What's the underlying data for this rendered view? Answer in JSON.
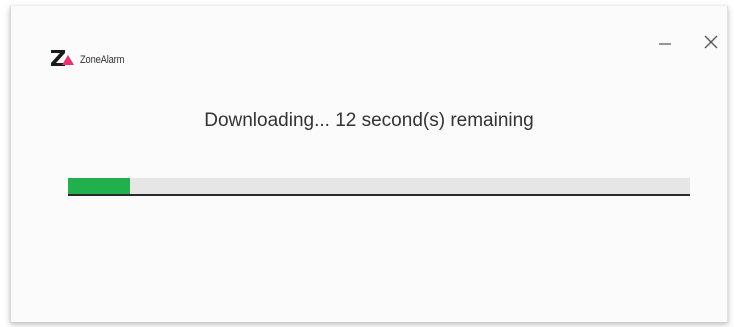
{
  "app": {
    "name": "ZoneAlarm",
    "brand_colors": {
      "logo_dark": "#1a1a1a",
      "logo_accent": "#e6336b"
    },
    "icon": "zonealarm-logo-icon"
  },
  "window_controls": {
    "minimize_icon": "minimize-icon",
    "close_icon": "close-icon"
  },
  "download": {
    "status_text": "Downloading... 12 second(s) remaining",
    "progress_fraction": 0.1,
    "progress_color": "#22b04c",
    "track_color": "#e6e6e6"
  }
}
